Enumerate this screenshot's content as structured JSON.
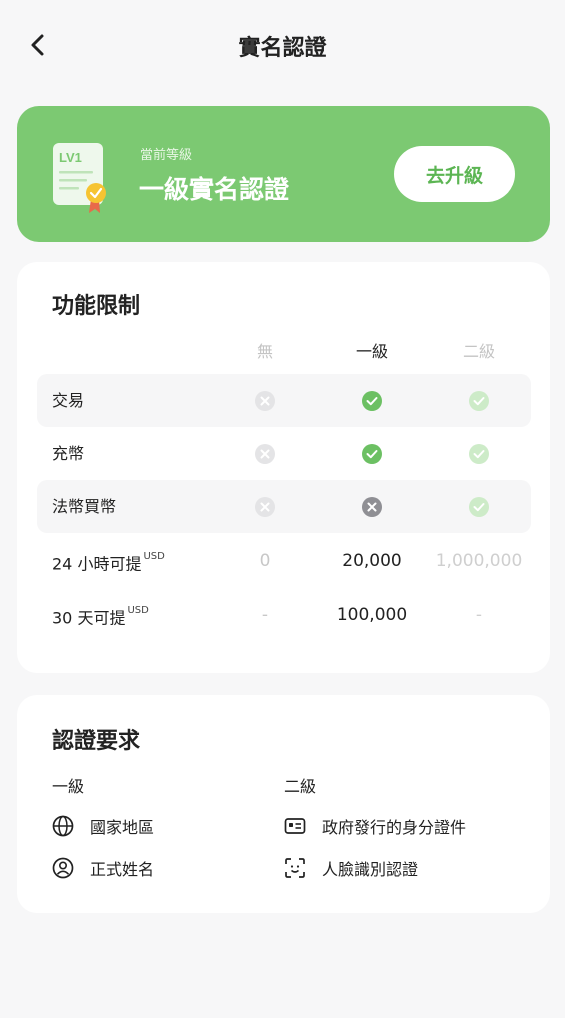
{
  "header": {
    "title": "實名認證",
    "back_icon": "chevron-left-icon"
  },
  "level_card": {
    "badge": "LV1",
    "subtitle": "當前等級",
    "level_name": "一級實名認證",
    "upgrade_label": "去升級",
    "colors": {
      "background": "#7cc972",
      "button_text": "#5cb553"
    }
  },
  "limits": {
    "title": "功能限制",
    "columns": [
      "無",
      "一級",
      "二級"
    ],
    "rows": [
      {
        "label": "交易",
        "values": [
          "x",
          "check",
          "check"
        ]
      },
      {
        "label": "充幣",
        "values": [
          "x",
          "check",
          "check"
        ]
      },
      {
        "label": "法幣買幣",
        "values": [
          "x",
          "x",
          "check"
        ]
      },
      {
        "label": "24 小時可提",
        "unit": "USD",
        "values": [
          "0",
          "20,000",
          "1,000,000"
        ]
      },
      {
        "label": "30 天可提",
        "unit": "USD",
        "values": [
          "-",
          "100,000",
          "-"
        ]
      }
    ]
  },
  "requirements": {
    "title": "認證要求",
    "level1": {
      "heading": "一級",
      "items": [
        {
          "label": "國家地區",
          "icon": "globe-icon"
        },
        {
          "label": "正式姓名",
          "icon": "user-circle-icon"
        }
      ]
    },
    "level2": {
      "heading": "二級",
      "items": [
        {
          "label": "政府發行的身分證件",
          "icon": "id-card-icon"
        },
        {
          "label": "人臉識別認證",
          "icon": "face-scan-icon"
        }
      ]
    }
  }
}
